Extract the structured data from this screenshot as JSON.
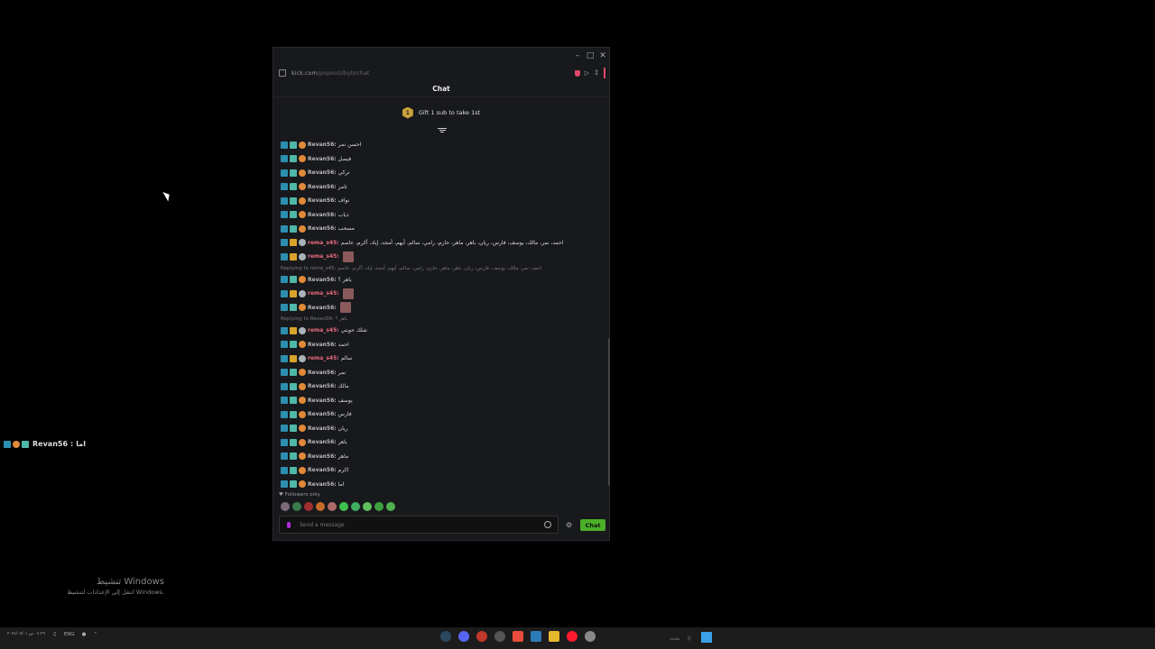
{
  "window": {
    "url_domain": "kick.com",
    "url_path": "/popout/ibyb/chat",
    "header": "Chat"
  },
  "gift": {
    "rank": "1",
    "text": "Gift 1 sub to take 1st"
  },
  "messages": [
    {
      "user": "Revan56:",
      "text": "احسن نمر",
      "type": "revan"
    },
    {
      "user": "Revan56:",
      "text": "فيصل",
      "type": "revan"
    },
    {
      "user": "Revan56:",
      "text": "تركي",
      "type": "revan"
    },
    {
      "user": "Revan56:",
      "text": "تامر",
      "type": "revan"
    },
    {
      "user": "Revan56:",
      "text": "نواف",
      "type": "revan"
    },
    {
      "user": "Revan56:",
      "text": "ذياب",
      "type": "revan"
    },
    {
      "user": "Revan56:",
      "text": "مسحب",
      "type": "revan"
    },
    {
      "user": "rema_s45:",
      "text": "احمد، نمر، مالك، يوسف، فارس، ريان، باهر، ماهر، حازم، رامي، سالم، أيهم، أمجد، إياد، أكرم، عاصم",
      "type": "rema"
    },
    {
      "user": "rema_s45:",
      "text": "",
      "type": "rema",
      "avatar": true
    },
    {
      "reply": "Replying to rema_s45: احمد، نمر، مالك، يوسف، فارس، ريان، باهر، ماهر، حازم، رامي، سالم، أيهم، أمجد، إياد، أكرم، عاصم"
    },
    {
      "user": "Revan56:",
      "text": "باهر ؟",
      "type": "revan"
    },
    {
      "user": "rema_s45:",
      "text": "",
      "type": "rema",
      "avatar": true
    },
    {
      "user": "Revan56:",
      "text": "",
      "type": "revan",
      "avatar": true
    },
    {
      "reply": "Replying to Revan56: باهر ؟"
    },
    {
      "user": "rema_s45:",
      "text": "شلك حوبتي",
      "type": "rema"
    },
    {
      "user": "Revan56:",
      "text": "احمد",
      "type": "revan"
    },
    {
      "user": "rema_s45:",
      "text": "سالم",
      "type": "rema"
    },
    {
      "user": "Revan56:",
      "text": "نمر",
      "type": "revan"
    },
    {
      "user": "Revan56:",
      "text": "مالك",
      "type": "revan"
    },
    {
      "user": "Revan56:",
      "text": "يوسف",
      "type": "revan"
    },
    {
      "user": "Revan56:",
      "text": "فارس",
      "type": "revan"
    },
    {
      "user": "Revan56:",
      "text": "ريان",
      "type": "revan"
    },
    {
      "user": "Revan56:",
      "text": "باهر",
      "type": "revan"
    },
    {
      "user": "Revan56:",
      "text": "ماهر",
      "type": "revan"
    },
    {
      "user": "Revan56:",
      "text": "اكرم",
      "type": "revan"
    },
    {
      "user": "Revan56:",
      "text": "اما",
      "type": "revan"
    }
  ],
  "followers_only": "Followers only",
  "input": {
    "placeholder": "Send a message"
  },
  "chat_button": "Chat",
  "overlay": {
    "user": "Revan56",
    "sep": ":",
    "text": "اما"
  },
  "activation": {
    "title": "تنشيط Windows",
    "subtitle": "انتقل إلى الإعدادات لتنشيط Windows."
  },
  "taskbar": {
    "lang": "ENG",
    "search": "بحث",
    "clock": "٠٤:٢٩ ص ٢٠٢٤/٠٧/٠١"
  },
  "colors": {
    "accent_green": "#4caf28",
    "rema_name": "#e86a7f",
    "revan_name": "#b8b8b8"
  }
}
